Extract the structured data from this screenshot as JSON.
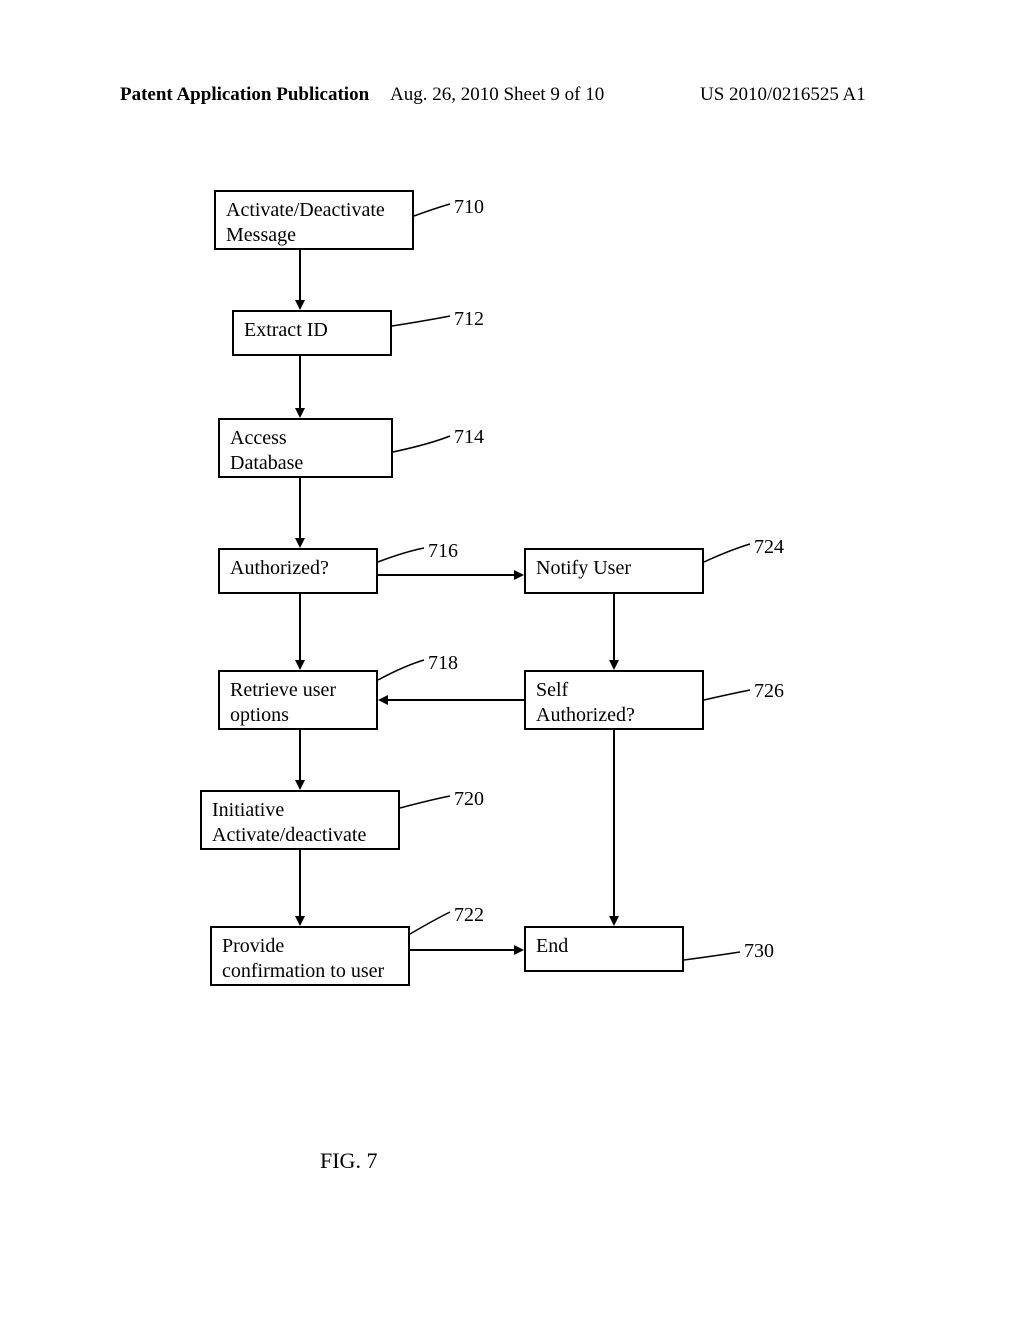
{
  "header": {
    "left": "Patent Application Publication",
    "mid": "Aug. 26, 2010  Sheet 9 of 10",
    "right": "US 2010/0216525 A1"
  },
  "boxes": {
    "b710": "Activate/Deactivate\nMessage",
    "b712": "Extract ID",
    "b714": "Access\nDatabase",
    "b716": "Authorized?",
    "b718": "Retrieve user\noptions",
    "b720": "Initiative\nActivate/deactivate",
    "b722": "Provide\nconfirmation to user",
    "b724": "Notify User",
    "b726": "Self\nAuthorized?",
    "b730": "End"
  },
  "refs": {
    "r710": "710",
    "r712": "712",
    "r714": "714",
    "r716": "716",
    "r718": "718",
    "r720": "720",
    "r722": "722",
    "r724": "724",
    "r726": "726",
    "r730": "730"
  },
  "figure_caption": "FIG.  7"
}
